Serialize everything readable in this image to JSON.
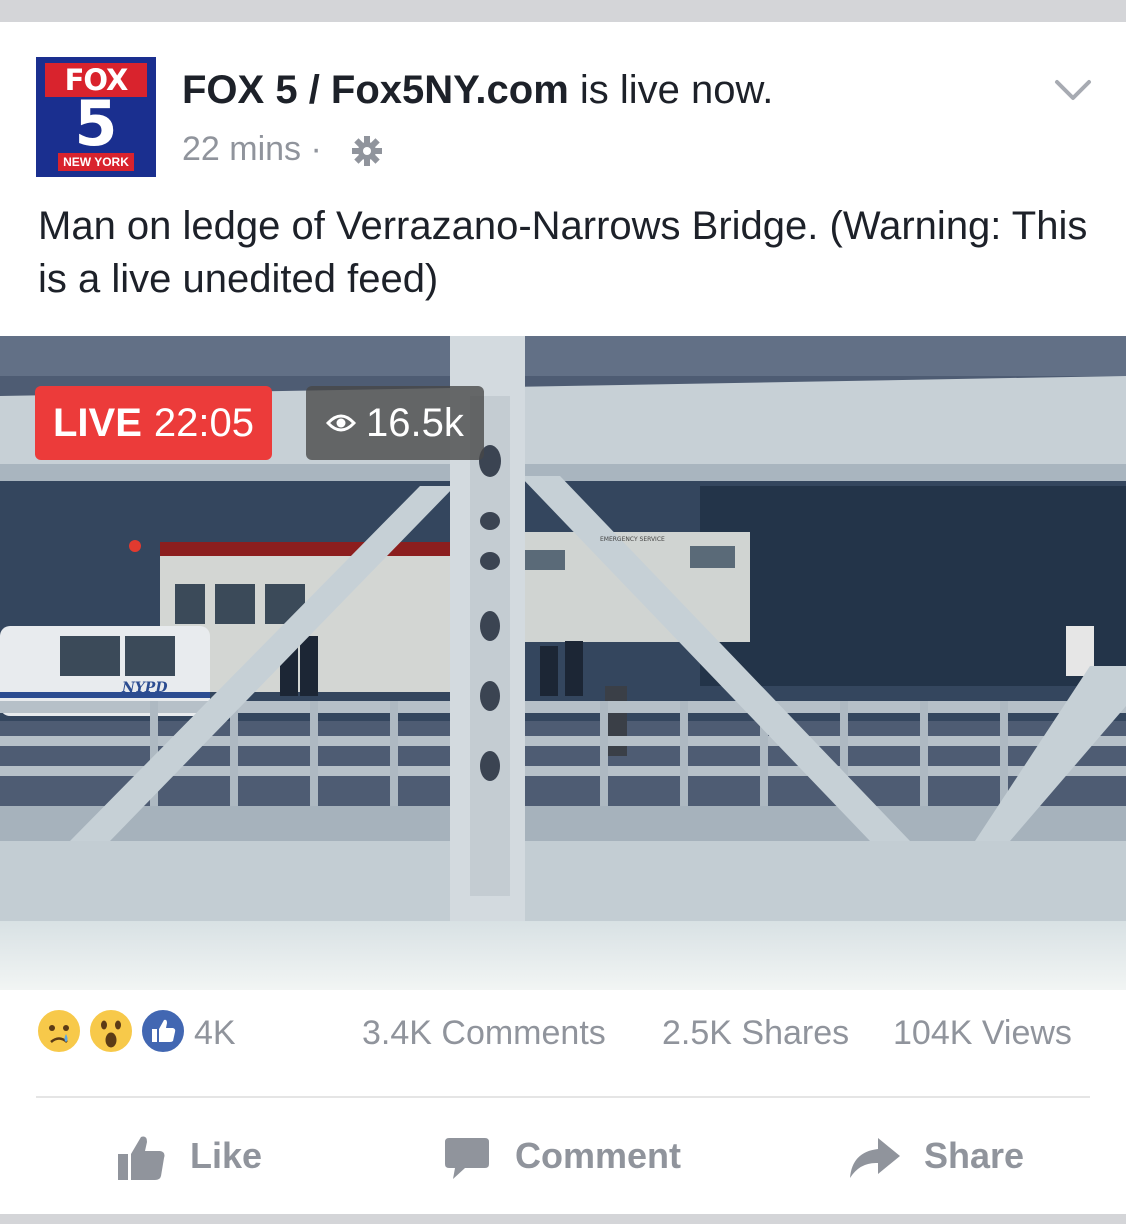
{
  "post": {
    "page_name": "FOX 5 / Fox5NY.com",
    "status": "is live now.",
    "time": "22 mins",
    "separator": "·",
    "text": "Man on ledge of Verrazano-Narrows Bridge. (Warning: This is a live unedited feed)",
    "logo": {
      "top": "FOX",
      "number": "5",
      "city": "NEW YORK"
    }
  },
  "video": {
    "live_label": "LIVE",
    "live_time": "22:05",
    "viewer_count": "16.5k",
    "scene_text": {
      "police_car": "NYPD",
      "truck_side": "EMERGENCY SERVICE"
    }
  },
  "stats": {
    "reaction_count": "4K",
    "reactions": [
      "sad-reaction-icon",
      "wow-reaction-icon",
      "like-reaction-icon"
    ],
    "comments": "3.4K Comments",
    "shares": "2.5K Shares",
    "views": "104K Views"
  },
  "actions": {
    "like": "Like",
    "comment": "Comment",
    "share": "Share"
  },
  "colors": {
    "live_red": "#ec3b3a",
    "fb_blue": "#4267b2",
    "muted_text": "#90949c",
    "fox_blue": "#1a2f8f",
    "fox_red": "#d9232d"
  }
}
